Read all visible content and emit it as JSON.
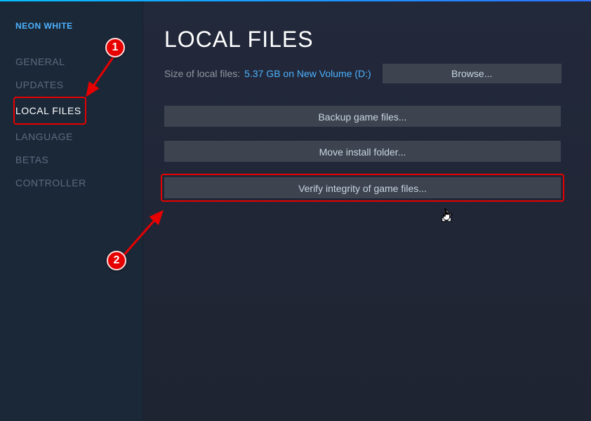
{
  "app_title": "NEON WHITE",
  "sidebar": {
    "items": [
      {
        "label": "GENERAL"
      },
      {
        "label": "UPDATES"
      },
      {
        "label": "LOCAL FILES"
      },
      {
        "label": "LANGUAGE"
      },
      {
        "label": "BETAS"
      },
      {
        "label": "CONTROLLER"
      }
    ]
  },
  "page": {
    "title": "LOCAL FILES",
    "size_label": "Size of local files:",
    "size_value": "5.37 GB on New Volume (D:)",
    "browse_label": "Browse...",
    "backup_label": "Backup game files...",
    "move_label": "Move install folder...",
    "verify_label": "Verify integrity of game files..."
  },
  "annotations": {
    "badge1": "1",
    "badge2": "2"
  }
}
